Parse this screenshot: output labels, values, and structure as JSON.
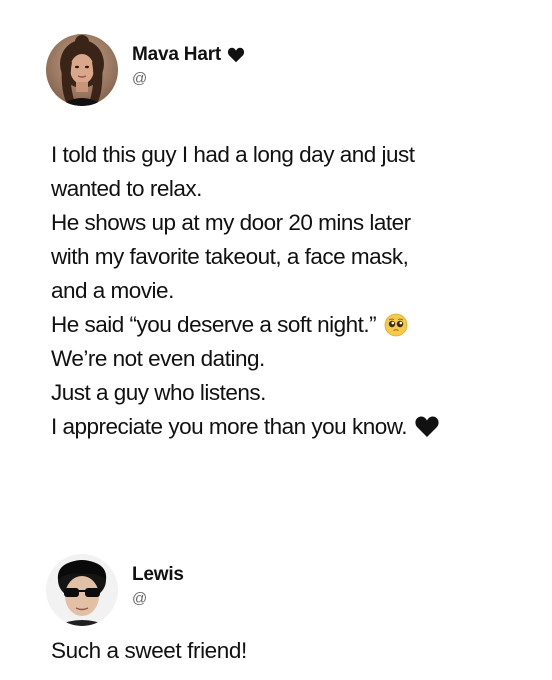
{
  "main_post": {
    "author": {
      "name": "Mava Hart",
      "handle": "@",
      "badge_icon": "black-heart-icon"
    },
    "lines": [
      {
        "text": "I told this guy I had a long day and just"
      },
      {
        "text": "wanted to relax."
      },
      {
        "text": "He shows up at my door 20 mins later"
      },
      {
        "text": "with my favorite takeout, a face mask,"
      },
      {
        "text": "and a movie."
      },
      {
        "text": "He said “you deserve a soft night.”",
        "emoji": "pleading-face-icon"
      },
      {
        "text": "We’re not even dating."
      },
      {
        "text": "Just a guy who listens."
      },
      {
        "text": "I appreciate you more than you know.",
        "emoji": "black-heart-icon"
      }
    ]
  },
  "reply_post": {
    "author": {
      "name": "Lewis",
      "handle": "@"
    },
    "text": "Such a sweet friend!"
  },
  "colors": {
    "background": "#ffffff",
    "text": "#111111",
    "handle": "#6b6b6b",
    "emoji_yellow": "#f7c948"
  }
}
